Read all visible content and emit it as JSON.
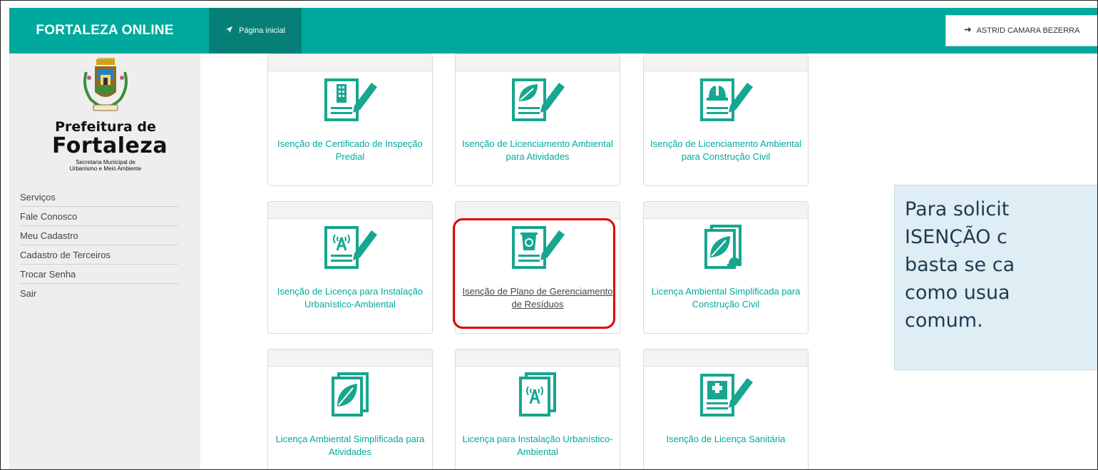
{
  "header": {
    "brand": "FORTALEZA ONLINE",
    "home_tab": "Página inicial",
    "user_button": "ASTRID CAMARA BEZERRA",
    "brand_color": "#00a99d",
    "active_tab_color": "#067f77"
  },
  "logo": {
    "line1": "Prefeitura de",
    "line2": "Fortaleza",
    "line3a": "Secretaria Municipal de",
    "line3b": "Urbanismo e Meio Ambiente",
    "crest_banner": "FORTITUDINE"
  },
  "sidebar": {
    "items": [
      {
        "label": "Serviços"
      },
      {
        "label": "Fale Conosco"
      },
      {
        "label": "Meu Cadastro"
      },
      {
        "label": "Cadastro de Terceiros"
      },
      {
        "label": "Trocar Senha"
      },
      {
        "label": "Sair"
      }
    ]
  },
  "cards": [
    {
      "label": "Isenção de Certificado de Inspeção Predial",
      "icon": "building-document-icon"
    },
    {
      "label": "Isenção de Licenciamento Ambiental para Atividades",
      "icon": "leaf-document-icon"
    },
    {
      "label": "Isenção de Licenciamento Ambiental para Construção Civil",
      "icon": "helmet-document-icon"
    },
    {
      "label": "Isenção de Licença para Instalação Urbanístico-Ambiental",
      "icon": "antenna-document-icon"
    },
    {
      "label": "Isenção de Plano de Gerenciamento de Resíduos",
      "icon": "recycle-document-icon",
      "highlighted": true
    },
    {
      "label": "Licença Ambiental Simplificada para Construção Civil",
      "icon": "leaf-helmet-document-icon"
    },
    {
      "label": "Licença Ambiental Simplificada para Atividades",
      "icon": "leaf-document-icon"
    },
    {
      "label": "Licença para Instalação Urbanístico-Ambiental",
      "icon": "antenna-document-icon"
    },
    {
      "label": "Isenção de Licença Sanitária",
      "icon": "hospital-document-icon"
    }
  ],
  "callout": {
    "text": "Para solicit ISENÇÃO c basta se ca como usua comum."
  }
}
